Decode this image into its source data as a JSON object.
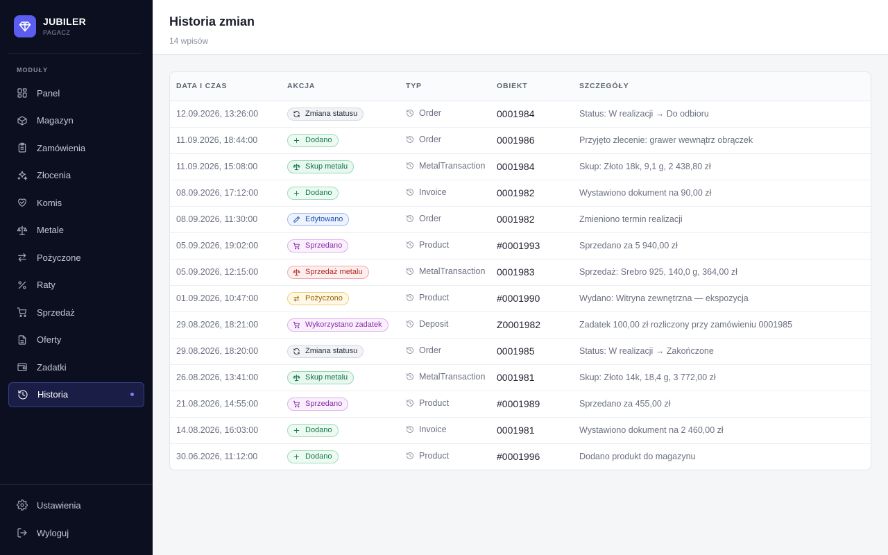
{
  "app": {
    "name": "JUBILER",
    "subtitle": "PAGACZ"
  },
  "sidebar": {
    "section_label": "MODUŁY",
    "items": [
      {
        "label": "Panel",
        "icon": "grid-icon",
        "key": "panel"
      },
      {
        "label": "Magazyn",
        "icon": "box-icon",
        "key": "magazyn"
      },
      {
        "label": "Zamówienia",
        "icon": "clipboard-icon",
        "key": "zamowienia"
      },
      {
        "label": "Złocenia",
        "icon": "sparkles-icon",
        "key": "zlocenia"
      },
      {
        "label": "Komis",
        "icon": "handshake-icon",
        "key": "komis"
      },
      {
        "label": "Metale",
        "icon": "scale-icon",
        "key": "metale"
      },
      {
        "label": "Pożyczone",
        "icon": "arrows-exchange-icon",
        "key": "pozyczone"
      },
      {
        "label": "Raty",
        "icon": "percent-icon",
        "key": "raty"
      },
      {
        "label": "Sprzedaż",
        "icon": "cart-icon",
        "key": "sprzedaz"
      },
      {
        "label": "Oferty",
        "icon": "document-icon",
        "key": "oferty"
      },
      {
        "label": "Zadatki",
        "icon": "wallet-icon",
        "key": "zadatki"
      },
      {
        "label": "Historia",
        "icon": "history-icon",
        "key": "historia",
        "active": true
      }
    ],
    "bottom": [
      {
        "label": "Ustawienia",
        "icon": "gear-icon",
        "key": "ustawienia"
      },
      {
        "label": "Wyloguj",
        "icon": "logout-icon",
        "key": "wyloguj"
      }
    ]
  },
  "page": {
    "title": "Historia zmian",
    "subtitle": "14 wpisów"
  },
  "table": {
    "columns": [
      "DATA I CZAS",
      "AKCJA",
      "TYP",
      "OBIEKT",
      "SZCZEGÓŁY"
    ],
    "rows": [
      {
        "date": "12.09.2026, 13:26:00",
        "action": "Zmiana statusu",
        "kind": "status",
        "type": "Order",
        "object": "0001984",
        "details": "Status: W realizacji → Do odbioru"
      },
      {
        "date": "11.09.2026, 18:44:00",
        "action": "Dodano",
        "kind": "added",
        "type": "Order",
        "object": "0001986",
        "details": "Przyjęto zlecenie: grawer wewnątrz obrączek"
      },
      {
        "date": "11.09.2026, 15:08:00",
        "action": "Skup metalu",
        "kind": "buy",
        "type": "MetalTransaction",
        "object": "0001984",
        "details": "Skup: Złoto 18k, 9,1 g, 2 438,80 zł"
      },
      {
        "date": "08.09.2026, 17:12:00",
        "action": "Dodano",
        "kind": "added",
        "type": "Invoice",
        "object": "0001982",
        "details": "Wystawiono dokument na 90,00 zł"
      },
      {
        "date": "08.09.2026, 11:30:00",
        "action": "Edytowano",
        "kind": "edited",
        "type": "Order",
        "object": "0001982",
        "details": "Zmieniono termin realizacji"
      },
      {
        "date": "05.09.2026, 19:02:00",
        "action": "Sprzedano",
        "kind": "sold",
        "type": "Product",
        "object": "#0001993",
        "details": "Sprzedano za 5 940,00 zł"
      },
      {
        "date": "05.09.2026, 12:15:00",
        "action": "Sprzedaż metalu",
        "kind": "metalsale",
        "type": "MetalTransaction",
        "object": "0001983",
        "details": "Sprzedaż: Srebro 925, 140,0 g, 364,00 zł"
      },
      {
        "date": "01.09.2026, 10:47:00",
        "action": "Pożyczono",
        "kind": "lent",
        "type": "Product",
        "object": "#0001990",
        "details": "Wydano: Witryna zewnętrzna — ekspozycja"
      },
      {
        "date": "29.08.2026, 18:21:00",
        "action": "Wykorzystano zadatek",
        "kind": "deposit",
        "type": "Deposit",
        "object": "Z0001982",
        "details": "Zadatek 100,00 zł rozliczony przy zamówieniu 0001985"
      },
      {
        "date": "29.08.2026, 18:20:00",
        "action": "Zmiana statusu",
        "kind": "status",
        "type": "Order",
        "object": "0001985",
        "details": "Status: W realizacji → Zakończone"
      },
      {
        "date": "26.08.2026, 13:41:00",
        "action": "Skup metalu",
        "kind": "buy",
        "type": "MetalTransaction",
        "object": "0001981",
        "details": "Skup: Złoto 14k, 18,4 g, 3 772,00 zł"
      },
      {
        "date": "21.08.2026, 14:55:00",
        "action": "Sprzedano",
        "kind": "sold",
        "type": "Product",
        "object": "#0001989",
        "details": "Sprzedano za 455,00 zł"
      },
      {
        "date": "14.08.2026, 16:03:00",
        "action": "Dodano",
        "kind": "added",
        "type": "Invoice",
        "object": "0001981",
        "details": "Wystawiono dokument na 2 460,00 zł"
      },
      {
        "date": "30.06.2026, 11:12:00",
        "action": "Dodano",
        "kind": "added",
        "type": "Product",
        "object": "#0001996",
        "details": "Dodano produkt do magazynu"
      }
    ]
  },
  "badge_styles": {
    "status": {
      "icon": "refresh-icon",
      "bg": "#f2f3f6",
      "border": "#d5d8e0",
      "color": "#2a2f3d"
    },
    "added": {
      "icon": "plus-icon",
      "bg": "#ecfaf2",
      "border": "#9fdcbc",
      "color": "#137a4a"
    },
    "buy": {
      "icon": "scale-icon",
      "bg": "#e8f8f0",
      "border": "#93d8b5",
      "color": "#117045"
    },
    "edited": {
      "icon": "pencil-icon",
      "bg": "#eef4ff",
      "border": "#9ebcf0",
      "color": "#1f4fb0"
    },
    "sold": {
      "icon": "cart-icon",
      "bg": "#faf0fd",
      "border": "#dcaeea",
      "color": "#8a2aa8"
    },
    "metalsale": {
      "icon": "scale-icon",
      "bg": "#fdeeee",
      "border": "#f0a9a9",
      "color": "#b3261e"
    },
    "lent": {
      "icon": "arrows-exchange-icon",
      "bg": "#fff8e6",
      "border": "#f1cf74",
      "color": "#9a6200"
    },
    "deposit": {
      "icon": "cart-icon",
      "bg": "#faf0fd",
      "border": "#dcaeea",
      "color": "#8a2aa8"
    }
  },
  "colors": {
    "accent": "#5b5cf0",
    "sidebar_bg": "#0b0f1f",
    "active_bg": "#1a1d45",
    "active_dot": "#7c7ff5"
  }
}
